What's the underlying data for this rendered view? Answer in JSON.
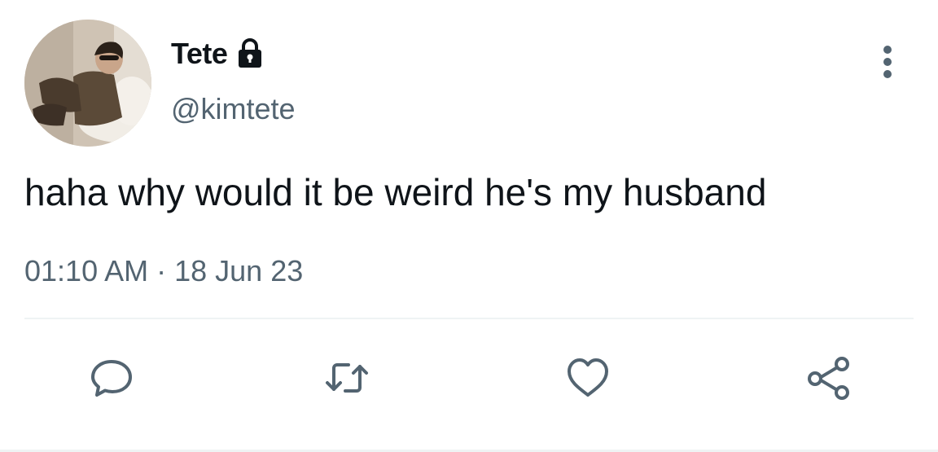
{
  "tweet": {
    "author": {
      "display_name": "Tete",
      "handle": "@kimtete",
      "protected_icon": "lock-icon",
      "avatar": "profile-photo"
    },
    "text": "haha why would it be weird he's my husband",
    "time": "01:10 AM",
    "separator": "·",
    "date": "18 Jun 23"
  },
  "actions": [
    {
      "name": "reply",
      "icon": "speech-bubble-icon"
    },
    {
      "name": "retweet",
      "icon": "retweet-icon"
    },
    {
      "name": "like",
      "icon": "heart-icon"
    },
    {
      "name": "share",
      "icon": "share-icon"
    }
  ],
  "colors": {
    "text": "#0f1419",
    "secondary": "#536471",
    "divider": "#eff3f4",
    "background": "#ffffff"
  }
}
